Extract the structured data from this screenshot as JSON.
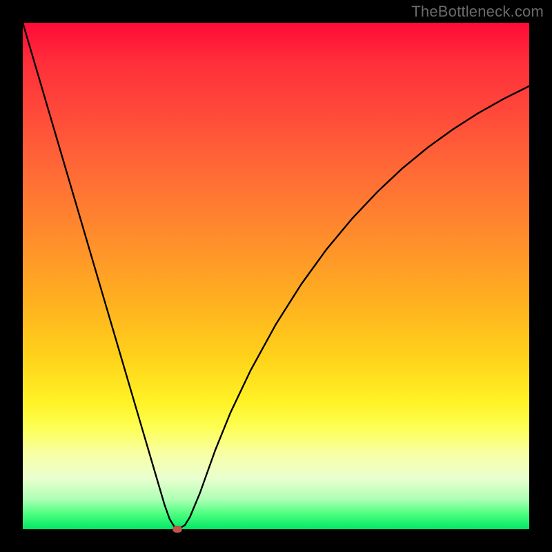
{
  "watermark": "TheBottleneck.com",
  "colors": {
    "background": "#000000",
    "watermark_text": "#6a6a6a",
    "curve_stroke": "#000000",
    "marker_fill": "#c0574c"
  },
  "chart_data": {
    "type": "line",
    "title": "",
    "xlabel": "",
    "ylabel": "",
    "xlim": [
      0,
      100
    ],
    "ylim": [
      0,
      100
    ],
    "grid": false,
    "legend": false,
    "x": [
      0,
      2,
      4,
      6,
      8,
      10,
      12,
      14,
      16,
      18,
      20,
      22,
      24,
      26,
      27,
      28,
      29,
      30,
      31,
      32,
      33,
      35,
      38,
      41,
      45,
      50,
      55,
      60,
      65,
      70,
      75,
      80,
      85,
      90,
      95,
      100
    ],
    "values": [
      100.0,
      93.2,
      86.4,
      79.6,
      72.8,
      66.0,
      59.2,
      52.4,
      45.6,
      38.8,
      32.0,
      25.2,
      18.4,
      11.6,
      8.2,
      4.8,
      2.0,
      0.4,
      0.2,
      0.8,
      2.4,
      7.2,
      15.6,
      23.0,
      31.4,
      40.5,
      48.4,
      55.3,
      61.3,
      66.6,
      71.3,
      75.4,
      79.0,
      82.2,
      85.0,
      87.5
    ],
    "marker": {
      "x": 30.5,
      "y": 0.0
    },
    "gradient_bands": [
      {
        "stop": 0.0,
        "color": "#ff0b38"
      },
      {
        "stop": 0.3,
        "color": "#ff6c36"
      },
      {
        "stop": 0.55,
        "color": "#ffb020"
      },
      {
        "stop": 0.75,
        "color": "#fff326"
      },
      {
        "stop": 0.9,
        "color": "#e9ffcf"
      },
      {
        "stop": 1.0,
        "color": "#00e765"
      }
    ]
  }
}
